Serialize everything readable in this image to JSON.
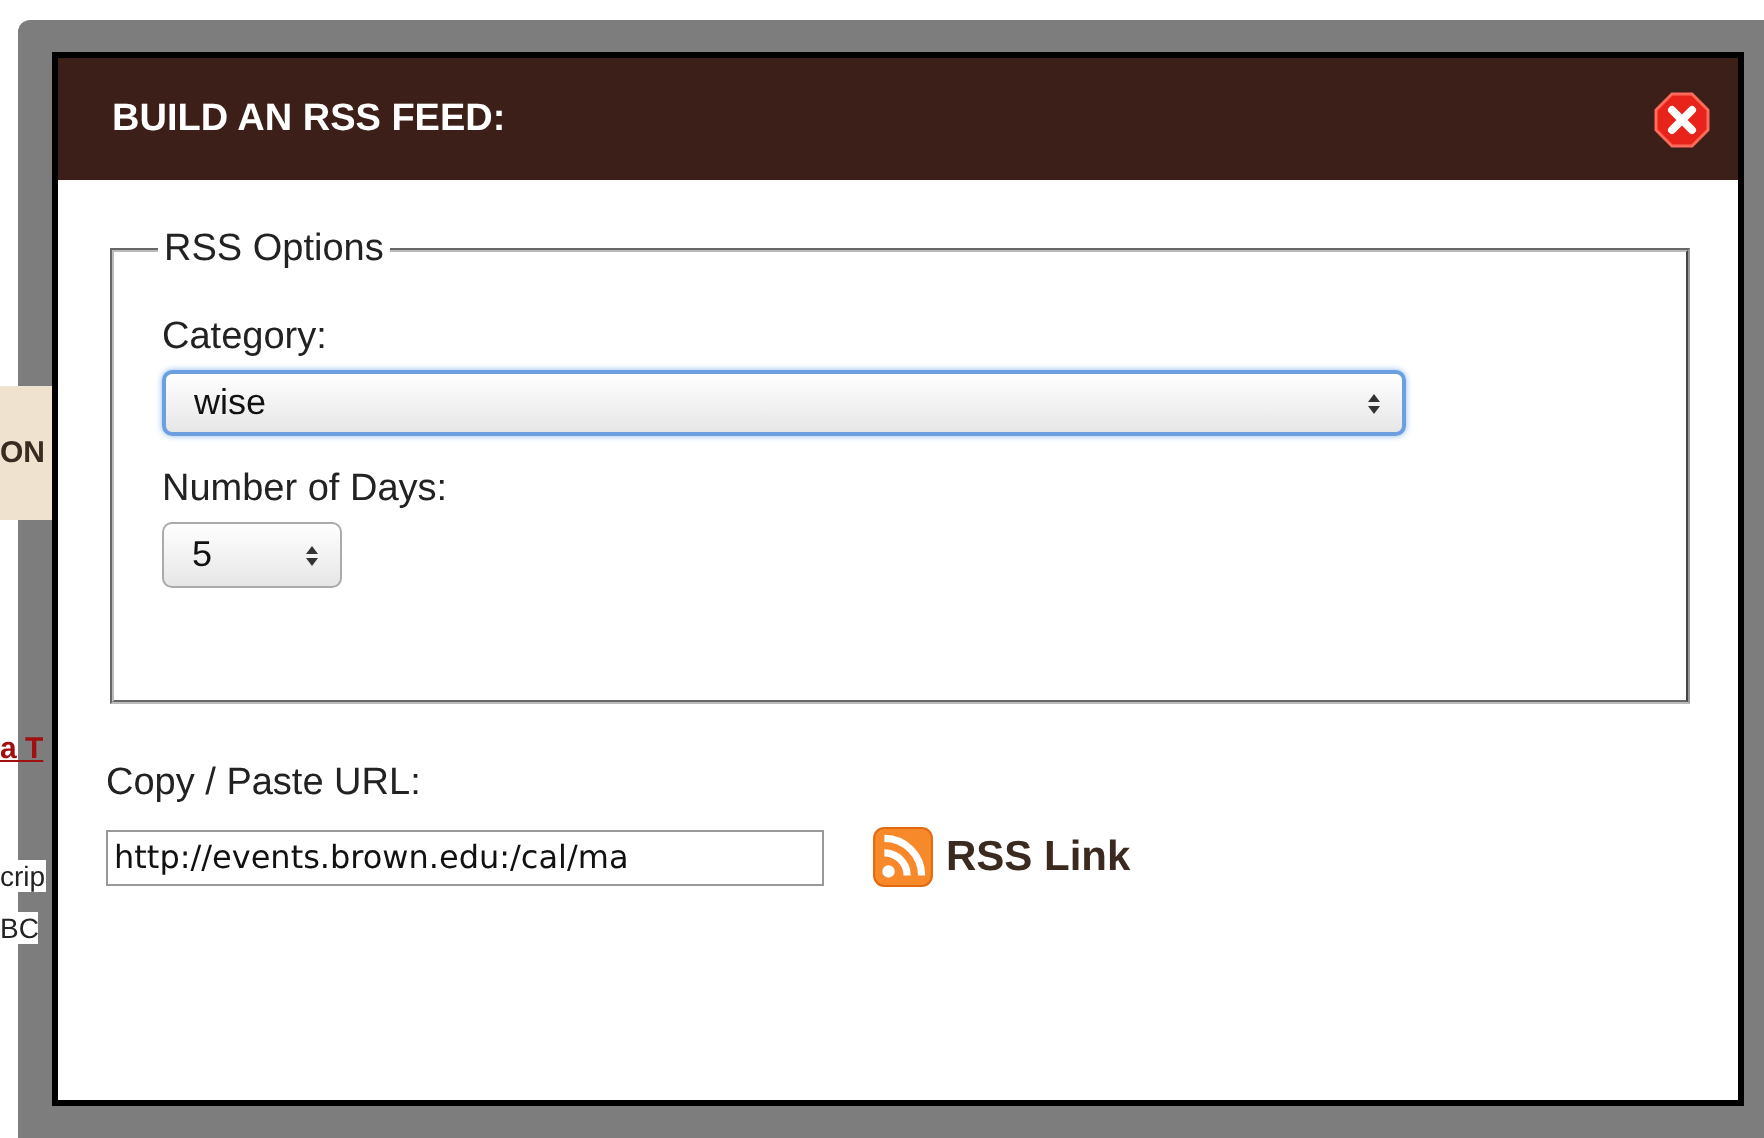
{
  "background_page": {
    "fragments": [
      {
        "kind": "band",
        "text": "ON"
      },
      {
        "kind": "link",
        "text": "a T"
      },
      {
        "kind": "plain",
        "text": "crip"
      },
      {
        "kind": "plain",
        "text": "BC"
      }
    ]
  },
  "dialog": {
    "title": "BUILD AN RSS FEED:",
    "options": {
      "legend": "RSS Options",
      "fields": [
        {
          "label": "Category:",
          "value": "wise",
          "kind": "wide",
          "focused": true
        },
        {
          "label": "Number of Days:",
          "value": "5",
          "kind": "narrow",
          "focused": false
        }
      ]
    },
    "url": {
      "label": "Copy / Paste URL:",
      "value": "http://events.brown.edu:/cal/ma"
    },
    "rss_link": "RSS Link"
  }
}
